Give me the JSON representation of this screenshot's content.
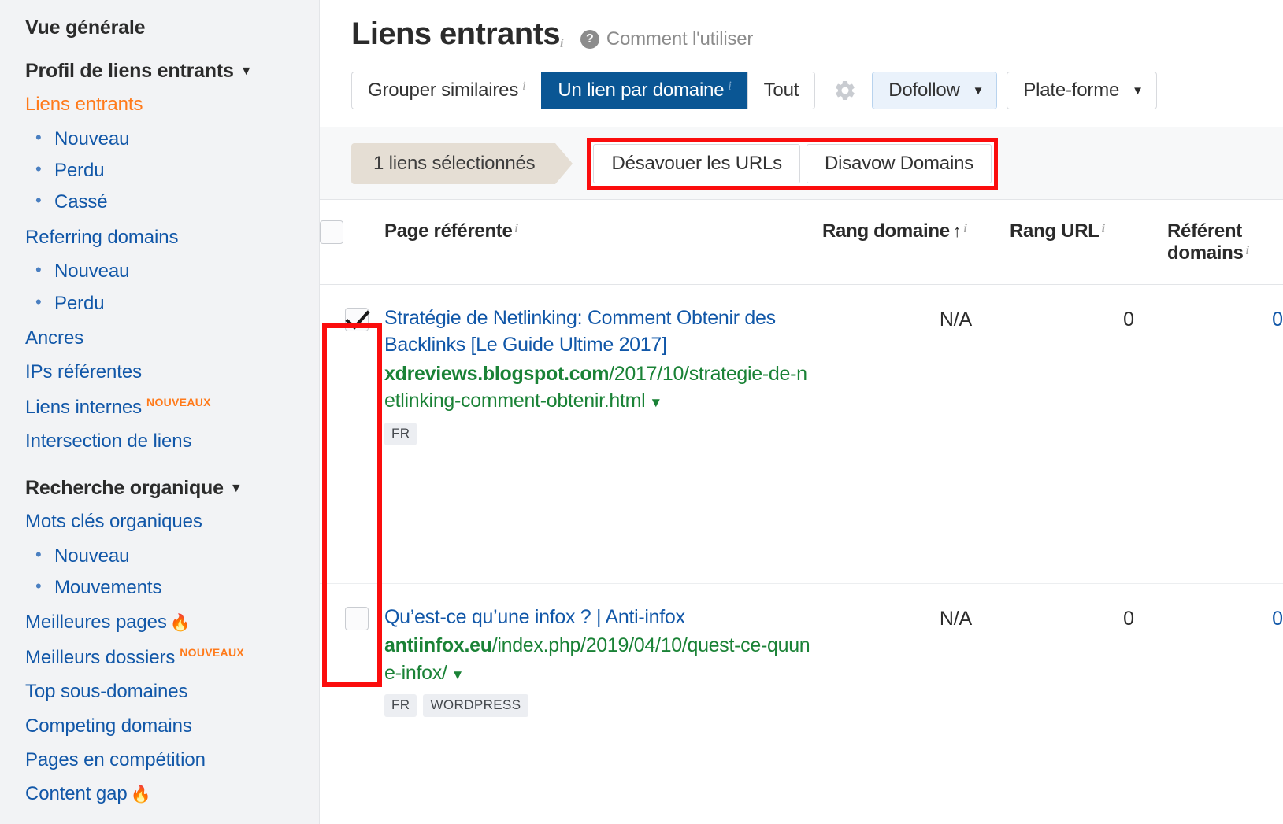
{
  "sidebar": {
    "overview_label": "Vue générale",
    "backlink_profile": {
      "label": "Profil de liens entrants",
      "caret": "caret-down-icon"
    },
    "backlinks_link": "Liens entrants",
    "backlinks_sub": [
      "Nouveau",
      "Perdu",
      "Cassé"
    ],
    "referring_domains_link": "Referring domains",
    "referring_domains_sub": [
      "Nouveau",
      "Perdu"
    ],
    "anchors_link": "Ancres",
    "referring_ips_link": "IPs référentes",
    "internal_links_link": "Liens internes",
    "internal_links_badge": "NOUVEAUX",
    "link_intersect_link": "Intersection de liens",
    "organic_search": {
      "label": "Recherche organique",
      "caret": "caret-down-icon"
    },
    "organic_keywords_link": "Mots clés organiques",
    "organic_keywords_sub": [
      "Nouveau",
      "Mouvements"
    ],
    "top_pages_link": "Meilleures pages",
    "top_pages_flame": "🔥",
    "best_folders_link": "Meilleurs dossiers",
    "best_folders_badge": "NOUVEAUX",
    "top_subdomains_link": "Top sous-domaines",
    "competing_domains_link": "Competing domains",
    "competing_pages_link": "Pages en compétition",
    "content_gap_link": "Content gap",
    "content_gap_flame": "🔥"
  },
  "header": {
    "title": "Liens entrants",
    "title_info": "i",
    "help_icon": "question-mark-icon",
    "help_text": "Comment l'utiliser"
  },
  "toolbar": {
    "segments": [
      {
        "label": "Grouper similaires",
        "info": "i",
        "selected": false
      },
      {
        "label": "Un lien par domaine",
        "info": "i",
        "selected": true
      },
      {
        "label": "Tout",
        "info": "",
        "selected": false
      }
    ],
    "gear_icon": "gear-icon",
    "filters": [
      {
        "label": "Dofollow",
        "caret": "▼",
        "tinted": true
      },
      {
        "label": "Plate-forme",
        "caret": "▼",
        "tinted": false
      }
    ]
  },
  "selection_bar": {
    "count_label": "1 liens sélectionnés",
    "disavow_urls_label": "Désavouer les URLs",
    "disavow_domains_label": "Disavow Domains",
    "highlight_color": "#fb0d0d"
  },
  "table": {
    "headers": {
      "check": "",
      "page": "Page référente",
      "page_info": "i",
      "domain_rank": "Rang domaine",
      "domain_rank_sort": "↑",
      "domain_rank_info": "i",
      "url_rank": "Rang URL",
      "url_rank_info": "i",
      "ref_domains_line1": "Référent",
      "ref_domains_line2": "domains",
      "ref_domains_info": "i"
    },
    "rows": [
      {
        "checked": true,
        "title": "Stratégie de Netlinking: Comment Obtenir des Backlinks [Le Guide Ultime 2017]",
        "url_domain": "xdreviews.blogspot.com",
        "url_path": "/2017/10/strategie-de-netlinking-comment-obtenir.html",
        "url_caret": "▼",
        "tags": [
          "FR"
        ],
        "domain_rank": "N/A",
        "url_rank": "0",
        "ref_domains": "0"
      },
      {
        "checked": false,
        "title": "Qu’est-ce qu’une infox ? | Anti-infox",
        "url_domain": "antiinfox.eu",
        "url_path": "/index.php/2019/04/10/quest-ce-quune-infox/",
        "url_caret": "▼",
        "tags": [
          "FR",
          "WORDPRESS"
        ],
        "domain_rank": "N/A",
        "url_rank": "0",
        "ref_domains": "0"
      }
    ]
  }
}
